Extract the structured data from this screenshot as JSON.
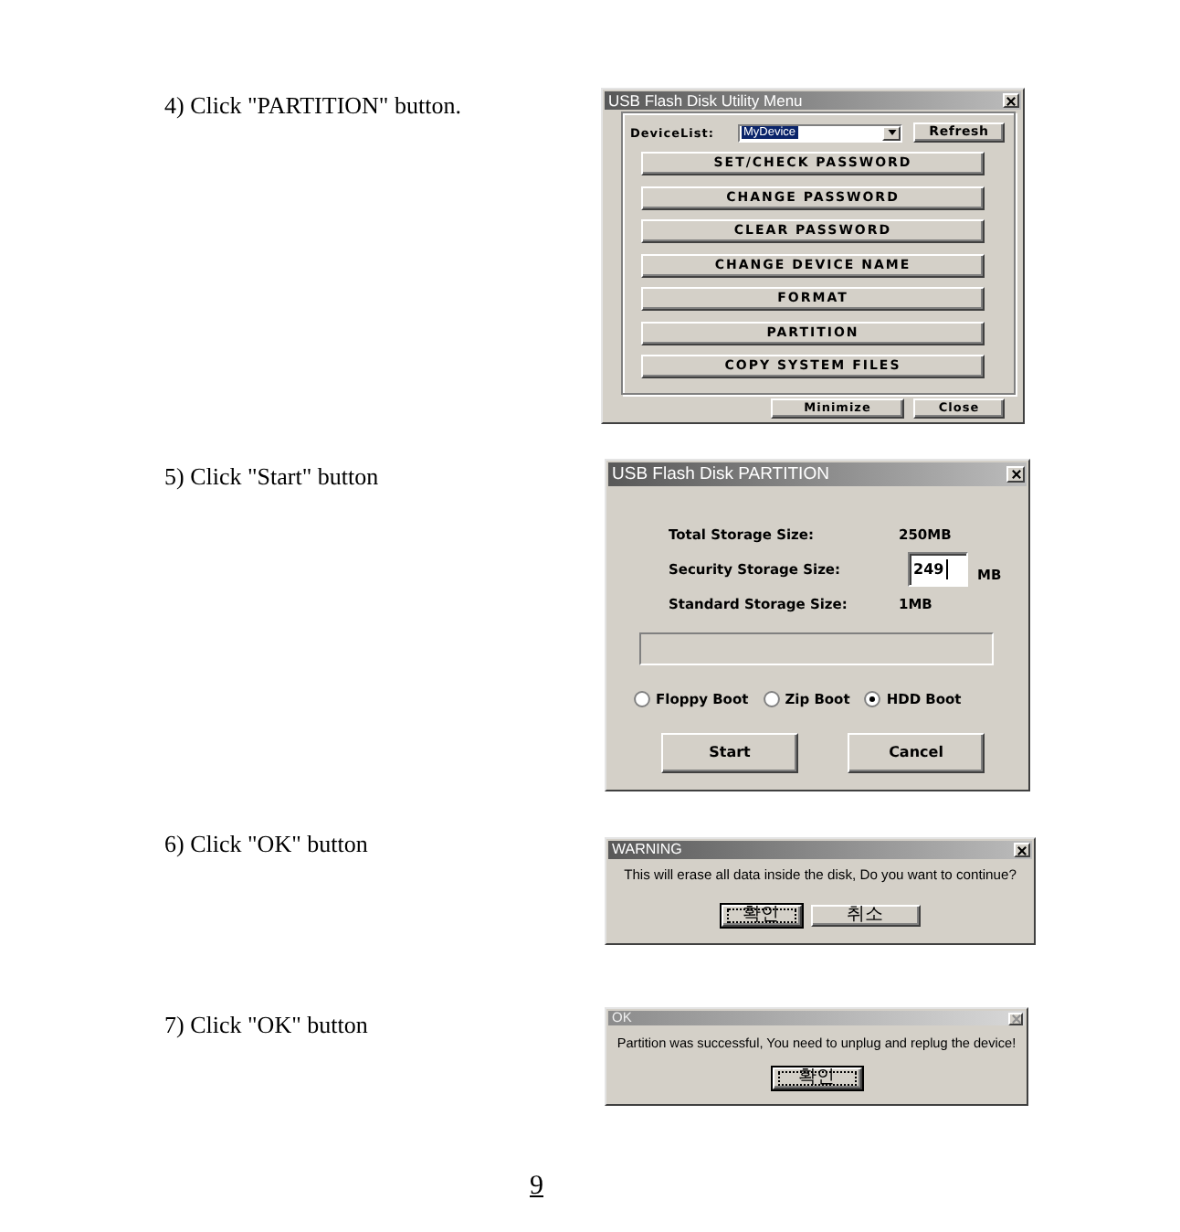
{
  "steps": [
    {
      "instruction": "4) Click \"PARTITION\" button.",
      "dialog": {
        "kind": "utility_menu",
        "title": "USB Flash Disk Utility Menu",
        "active": true,
        "device_list": {
          "label": "DeviceList:",
          "value": "MyDevice"
        },
        "refresh_button": "Refresh",
        "buttons": [
          "SET/CHECK PASSWORD",
          "CHANGE PASSWORD",
          "CLEAR PASSWORD",
          "CHANGE DEVICE NAME",
          "FORMAT",
          "PARTITION",
          "COPY SYSTEM FILES"
        ],
        "footer_buttons": [
          "Minimize",
          "Close"
        ]
      }
    },
    {
      "instruction": "5) Click \"Start\" button",
      "dialog": {
        "kind": "partition",
        "title": "USB Flash Disk PARTITION",
        "active": true,
        "rows": [
          {
            "kind": "text",
            "label": "Total Storage Size:",
            "value": "250MB"
          },
          {
            "kind": "input",
            "label": "Security Storage Size:",
            "value": "249",
            "unit": "MB"
          },
          {
            "kind": "text",
            "label": "Standard Storage Size:",
            "value": "1MB"
          }
        ],
        "boot_options": [
          {
            "label": "Floppy Boot",
            "selected": false
          },
          {
            "label": "Zip Boot",
            "selected": false
          },
          {
            "label": "HDD Boot",
            "selected": true
          }
        ],
        "buttons": [
          "Start",
          "Cancel"
        ]
      }
    },
    {
      "instruction": "6) Click \"OK\" button",
      "dialog": {
        "kind": "message",
        "title": "WARNING",
        "active": true,
        "message": "This will erase all data inside the disk, Do you want to continue?",
        "buttons": [
          {
            "label": "확인",
            "default": true
          },
          {
            "label": "취소",
            "default": false
          }
        ]
      }
    },
    {
      "instruction": "7) Click \"OK\" button",
      "dialog": {
        "kind": "message",
        "title": "OK",
        "active": false,
        "message": "Partition was successful, You need to unplug and replug the device!",
        "buttons": [
          {
            "label": "확인",
            "default": true
          }
        ]
      }
    }
  ],
  "page_number": "9"
}
